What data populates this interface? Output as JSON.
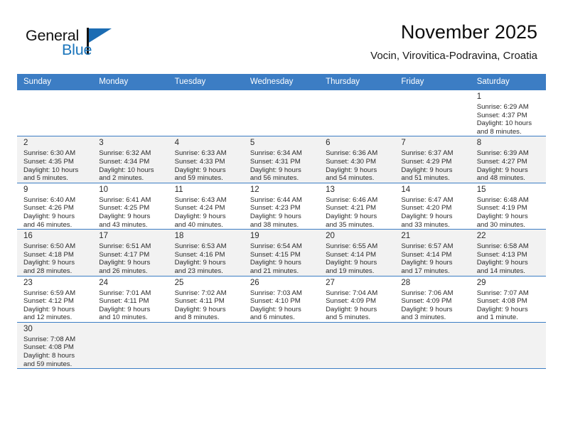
{
  "brand": {
    "name_part1": "General",
    "name_part2": "Blue",
    "flag_color": "#1b6cb3"
  },
  "header": {
    "title": "November 2025",
    "subtitle": "Vocin, Virovitica-Podravina, Croatia",
    "header_bg_color": "#3c7dc4"
  },
  "weekdays": [
    {
      "label": "Sunday"
    },
    {
      "label": "Monday"
    },
    {
      "label": "Tuesday"
    },
    {
      "label": "Wednesday"
    },
    {
      "label": "Thursday"
    },
    {
      "label": "Friday"
    },
    {
      "label": "Saturday"
    }
  ],
  "weeks": [
    {
      "shaded": false,
      "days": [
        {
          "empty": true
        },
        {
          "empty": true
        },
        {
          "empty": true
        },
        {
          "empty": true
        },
        {
          "empty": true
        },
        {
          "empty": true
        },
        {
          "day": "1",
          "sunrise": "Sunrise: 6:29 AM",
          "sunset": "Sunset: 4:37 PM",
          "daylight_line1": "Daylight: 10 hours",
          "daylight_line2": "and 8 minutes."
        }
      ]
    },
    {
      "shaded": true,
      "days": [
        {
          "day": "2",
          "sunrise": "Sunrise: 6:30 AM",
          "sunset": "Sunset: 4:35 PM",
          "daylight_line1": "Daylight: 10 hours",
          "daylight_line2": "and 5 minutes."
        },
        {
          "day": "3",
          "sunrise": "Sunrise: 6:32 AM",
          "sunset": "Sunset: 4:34 PM",
          "daylight_line1": "Daylight: 10 hours",
          "daylight_line2": "and 2 minutes."
        },
        {
          "day": "4",
          "sunrise": "Sunrise: 6:33 AM",
          "sunset": "Sunset: 4:33 PM",
          "daylight_line1": "Daylight: 9 hours",
          "daylight_line2": "and 59 minutes."
        },
        {
          "day": "5",
          "sunrise": "Sunrise: 6:34 AM",
          "sunset": "Sunset: 4:31 PM",
          "daylight_line1": "Daylight: 9 hours",
          "daylight_line2": "and 56 minutes."
        },
        {
          "day": "6",
          "sunrise": "Sunrise: 6:36 AM",
          "sunset": "Sunset: 4:30 PM",
          "daylight_line1": "Daylight: 9 hours",
          "daylight_line2": "and 54 minutes."
        },
        {
          "day": "7",
          "sunrise": "Sunrise: 6:37 AM",
          "sunset": "Sunset: 4:29 PM",
          "daylight_line1": "Daylight: 9 hours",
          "daylight_line2": "and 51 minutes."
        },
        {
          "day": "8",
          "sunrise": "Sunrise: 6:39 AM",
          "sunset": "Sunset: 4:27 PM",
          "daylight_line1": "Daylight: 9 hours",
          "daylight_line2": "and 48 minutes."
        }
      ]
    },
    {
      "shaded": false,
      "days": [
        {
          "day": "9",
          "sunrise": "Sunrise: 6:40 AM",
          "sunset": "Sunset: 4:26 PM",
          "daylight_line1": "Daylight: 9 hours",
          "daylight_line2": "and 46 minutes."
        },
        {
          "day": "10",
          "sunrise": "Sunrise: 6:41 AM",
          "sunset": "Sunset: 4:25 PM",
          "daylight_line1": "Daylight: 9 hours",
          "daylight_line2": "and 43 minutes."
        },
        {
          "day": "11",
          "sunrise": "Sunrise: 6:43 AM",
          "sunset": "Sunset: 4:24 PM",
          "daylight_line1": "Daylight: 9 hours",
          "daylight_line2": "and 40 minutes."
        },
        {
          "day": "12",
          "sunrise": "Sunrise: 6:44 AM",
          "sunset": "Sunset: 4:23 PM",
          "daylight_line1": "Daylight: 9 hours",
          "daylight_line2": "and 38 minutes."
        },
        {
          "day": "13",
          "sunrise": "Sunrise: 6:46 AM",
          "sunset": "Sunset: 4:21 PM",
          "daylight_line1": "Daylight: 9 hours",
          "daylight_line2": "and 35 minutes."
        },
        {
          "day": "14",
          "sunrise": "Sunrise: 6:47 AM",
          "sunset": "Sunset: 4:20 PM",
          "daylight_line1": "Daylight: 9 hours",
          "daylight_line2": "and 33 minutes."
        },
        {
          "day": "15",
          "sunrise": "Sunrise: 6:48 AM",
          "sunset": "Sunset: 4:19 PM",
          "daylight_line1": "Daylight: 9 hours",
          "daylight_line2": "and 30 minutes."
        }
      ]
    },
    {
      "shaded": true,
      "days": [
        {
          "day": "16",
          "sunrise": "Sunrise: 6:50 AM",
          "sunset": "Sunset: 4:18 PM",
          "daylight_line1": "Daylight: 9 hours",
          "daylight_line2": "and 28 minutes."
        },
        {
          "day": "17",
          "sunrise": "Sunrise: 6:51 AM",
          "sunset": "Sunset: 4:17 PM",
          "daylight_line1": "Daylight: 9 hours",
          "daylight_line2": "and 26 minutes."
        },
        {
          "day": "18",
          "sunrise": "Sunrise: 6:53 AM",
          "sunset": "Sunset: 4:16 PM",
          "daylight_line1": "Daylight: 9 hours",
          "daylight_line2": "and 23 minutes."
        },
        {
          "day": "19",
          "sunrise": "Sunrise: 6:54 AM",
          "sunset": "Sunset: 4:15 PM",
          "daylight_line1": "Daylight: 9 hours",
          "daylight_line2": "and 21 minutes."
        },
        {
          "day": "20",
          "sunrise": "Sunrise: 6:55 AM",
          "sunset": "Sunset: 4:14 PM",
          "daylight_line1": "Daylight: 9 hours",
          "daylight_line2": "and 19 minutes."
        },
        {
          "day": "21",
          "sunrise": "Sunrise: 6:57 AM",
          "sunset": "Sunset: 4:14 PM",
          "daylight_line1": "Daylight: 9 hours",
          "daylight_line2": "and 17 minutes."
        },
        {
          "day": "22",
          "sunrise": "Sunrise: 6:58 AM",
          "sunset": "Sunset: 4:13 PM",
          "daylight_line1": "Daylight: 9 hours",
          "daylight_line2": "and 14 minutes."
        }
      ]
    },
    {
      "shaded": false,
      "days": [
        {
          "day": "23",
          "sunrise": "Sunrise: 6:59 AM",
          "sunset": "Sunset: 4:12 PM",
          "daylight_line1": "Daylight: 9 hours",
          "daylight_line2": "and 12 minutes."
        },
        {
          "day": "24",
          "sunrise": "Sunrise: 7:01 AM",
          "sunset": "Sunset: 4:11 PM",
          "daylight_line1": "Daylight: 9 hours",
          "daylight_line2": "and 10 minutes."
        },
        {
          "day": "25",
          "sunrise": "Sunrise: 7:02 AM",
          "sunset": "Sunset: 4:11 PM",
          "daylight_line1": "Daylight: 9 hours",
          "daylight_line2": "and 8 minutes."
        },
        {
          "day": "26",
          "sunrise": "Sunrise: 7:03 AM",
          "sunset": "Sunset: 4:10 PM",
          "daylight_line1": "Daylight: 9 hours",
          "daylight_line2": "and 6 minutes."
        },
        {
          "day": "27",
          "sunrise": "Sunrise: 7:04 AM",
          "sunset": "Sunset: 4:09 PM",
          "daylight_line1": "Daylight: 9 hours",
          "daylight_line2": "and 5 minutes."
        },
        {
          "day": "28",
          "sunrise": "Sunrise: 7:06 AM",
          "sunset": "Sunset: 4:09 PM",
          "daylight_line1": "Daylight: 9 hours",
          "daylight_line2": "and 3 minutes."
        },
        {
          "day": "29",
          "sunrise": "Sunrise: 7:07 AM",
          "sunset": "Sunset: 4:08 PM",
          "daylight_line1": "Daylight: 9 hours",
          "daylight_line2": "and 1 minute."
        }
      ]
    },
    {
      "shaded": true,
      "days": [
        {
          "day": "30",
          "sunrise": "Sunrise: 7:08 AM",
          "sunset": "Sunset: 4:08 PM",
          "daylight_line1": "Daylight: 8 hours",
          "daylight_line2": "and 59 minutes."
        },
        {
          "empty": true
        },
        {
          "empty": true
        },
        {
          "empty": true
        },
        {
          "empty": true
        },
        {
          "empty": true
        },
        {
          "empty": true
        }
      ]
    }
  ]
}
